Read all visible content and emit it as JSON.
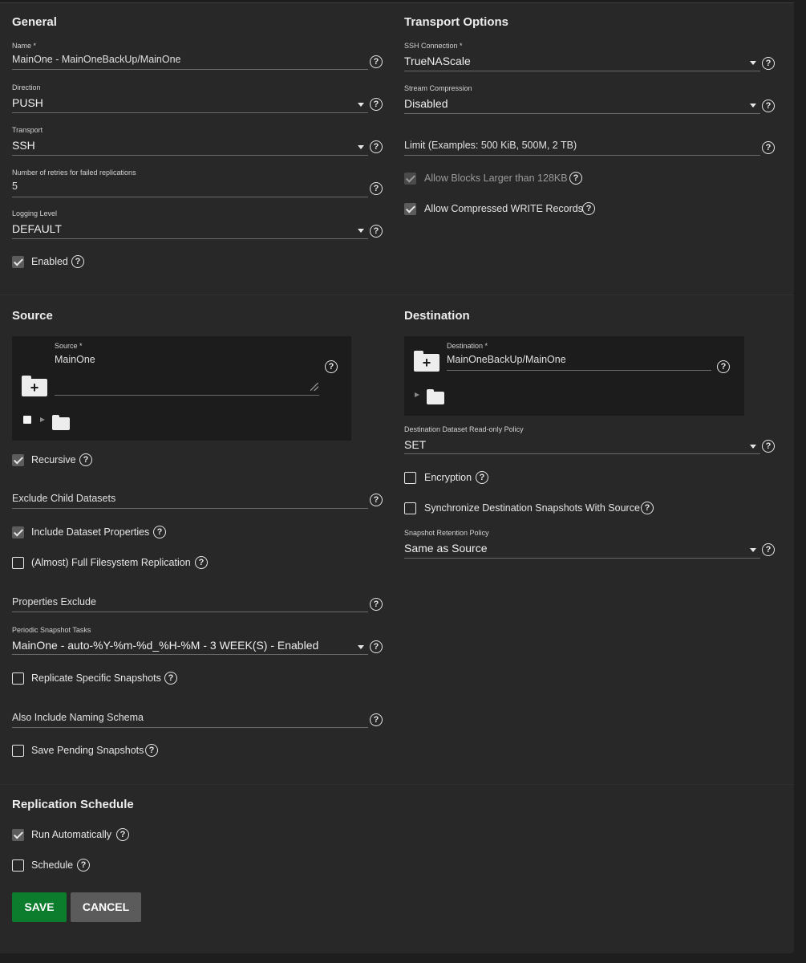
{
  "general": {
    "heading": "General",
    "name_label": "Name *",
    "name_value": "MainOne - MainOneBackUp/MainOne",
    "direction_label": "Direction",
    "direction_value": "PUSH",
    "transport_label": "Transport",
    "transport_value": "SSH",
    "retries_label": "Number of retries for failed replications",
    "retries_value": "5",
    "logging_label": "Logging Level",
    "logging_value": "DEFAULT",
    "enabled_label": "Enabled",
    "enabled_checked": true
  },
  "transport_options": {
    "heading": "Transport Options",
    "ssh_label": "SSH Connection *",
    "ssh_value": "TrueNAScale",
    "compression_label": "Stream Compression",
    "compression_value": "Disabled",
    "limit_placeholder": "Limit (Examples: 500 KiB, 500M, 2 TB)",
    "large_blocks_label": "Allow Blocks Larger than 128KB",
    "large_blocks_checked": true,
    "large_blocks_disabled": true,
    "compressed_write_label": "Allow Compressed WRITE Records",
    "compressed_write_checked": true
  },
  "source": {
    "heading": "Source",
    "source_label": "Source *",
    "source_value": "MainOne",
    "recursive_label": "Recursive",
    "recursive_checked": true,
    "exclude_child_placeholder": "Exclude Child Datasets",
    "include_props_label": "Include Dataset Properties",
    "include_props_checked": true,
    "full_fs_label": "(Almost) Full Filesystem Replication",
    "full_fs_checked": false,
    "props_exclude_placeholder": "Properties Exclude",
    "periodic_label": "Periodic Snapshot Tasks",
    "periodic_value": "MainOne - auto-%Y-%m-%d_%H-%M - 3 WEEK(S) - Enabled",
    "specific_snapshots_label": "Replicate Specific Snapshots",
    "specific_snapshots_checked": false,
    "naming_schema_placeholder": "Also Include Naming Schema",
    "save_pending_label": "Save Pending Snapshots",
    "save_pending_checked": false
  },
  "destination": {
    "heading": "Destination",
    "dest_label": "Destination *",
    "dest_value": "MainOneBackUp/MainOne",
    "readonly_label": "Destination Dataset Read-only Policy",
    "readonly_value": "SET",
    "encryption_label": "Encryption",
    "encryption_checked": false,
    "sync_label": "Synchronize Destination Snapshots With Source",
    "sync_checked": false,
    "retention_label": "Snapshot Retention Policy",
    "retention_value": "Same as Source"
  },
  "schedule": {
    "heading": "Replication Schedule",
    "run_auto_label": "Run Automatically",
    "run_auto_checked": true,
    "schedule_label": "Schedule",
    "schedule_checked": false
  },
  "actions": {
    "save_label": "SAVE",
    "cancel_label": "CANCEL"
  },
  "icons": {
    "help": "help-circle-icon",
    "dropdown": "caret-down-icon",
    "folder": "folder-icon",
    "folder_add": "folder-plus-icon"
  },
  "colors": {
    "background": "#1e1e1e",
    "card": "#282828",
    "save_button": "#0b7d2c",
    "cancel_button": "#5b5b5b"
  }
}
